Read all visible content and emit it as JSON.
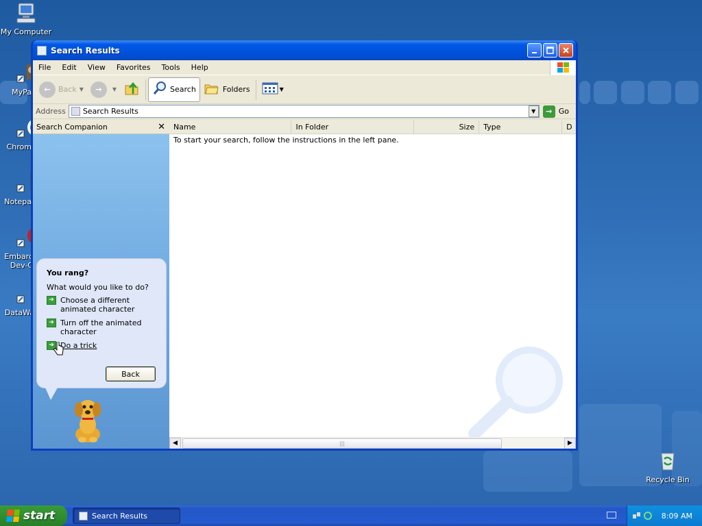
{
  "desktop": {
    "icons": [
      {
        "label": "My Computer"
      },
      {
        "label": "MyPa"
      },
      {
        "label": "Chrom"
      },
      {
        "label": "Notepa"
      },
      {
        "label": "Embarc\nDev-C"
      },
      {
        "label": "DataWa"
      },
      {
        "label": "Recycle Bin"
      }
    ]
  },
  "window": {
    "title": "Search Results",
    "menu": [
      "File",
      "Edit",
      "View",
      "Favorites",
      "Tools",
      "Help"
    ],
    "toolbar": {
      "back": "Back",
      "search": "Search",
      "folders": "Folders"
    },
    "address": {
      "label": "Address",
      "value": "Search Results",
      "go": "Go"
    },
    "companion": {
      "header": "Search Companion",
      "balloon": {
        "title": "You rang?",
        "question": "What would you like to do?",
        "options": [
          "Choose a different animated character",
          "Turn off the animated character",
          "Do a trick"
        ],
        "back": "Back"
      }
    },
    "results": {
      "columns": [
        "Name",
        "In Folder",
        "Size",
        "Type",
        "D"
      ],
      "message": "To start your search, follow the instructions in the left pane."
    }
  },
  "taskbar": {
    "start": "start",
    "task": "Search Results",
    "clock": "8:09 AM"
  },
  "colors": {
    "desktop": "#2d6bb3",
    "title_bar": "#0058e6",
    "start_button": "#2f8f2f",
    "link_arrow": "#3a9e3a"
  }
}
